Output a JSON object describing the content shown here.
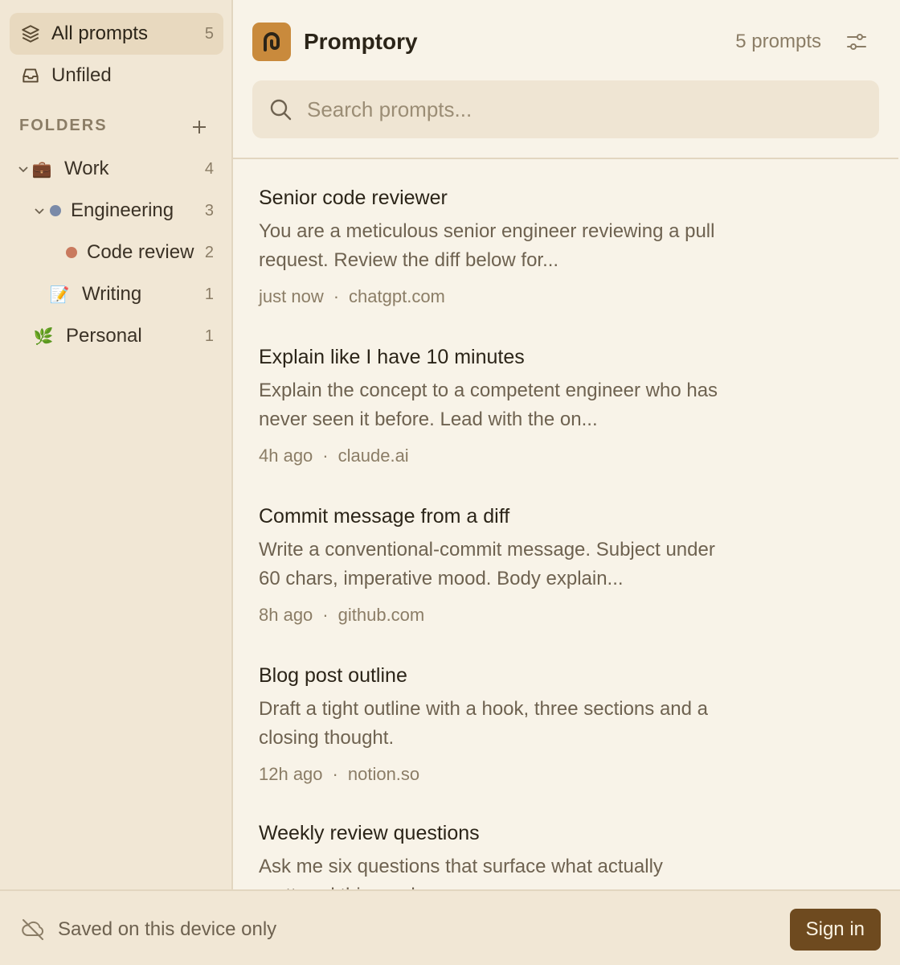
{
  "sidebar": {
    "all_prompts": {
      "label": "All prompts",
      "count": "5",
      "icon": "layers-icon"
    },
    "unfiled": {
      "label": "Unfiled",
      "icon": "inbox-icon"
    },
    "folders_label": "FOLDERS",
    "folders": [
      {
        "label": "Work",
        "count": "4",
        "icon": "briefcase",
        "emoji": "💼",
        "expanded": true
      },
      {
        "label": "Engineering",
        "count": "3",
        "dot_color": "#7a8aa8",
        "expanded": true
      },
      {
        "label": "Code review",
        "count": "2",
        "dot_color": "#c97a5e"
      },
      {
        "label": "Writing",
        "count": "1",
        "emoji": "📝"
      },
      {
        "label": "Personal",
        "count": "1",
        "emoji": "🌿"
      }
    ]
  },
  "header": {
    "title": "Promptory",
    "prompt_count": "5 prompts",
    "search_placeholder": "Search prompts..."
  },
  "prompts": [
    {
      "title": "Senior code reviewer",
      "body": "You are a meticulous senior engineer reviewing a pull request. Review the diff below for...",
      "time": "just now",
      "sep": "·",
      "source": "chatgpt.com"
    },
    {
      "title": "Explain like I have 10 minutes",
      "body": "Explain the concept to a competent engineer who has never seen it before. Lead with the on...",
      "time": "4h ago",
      "sep": "·",
      "source": "claude.ai"
    },
    {
      "title": "Commit message from a diff",
      "body": "Write a conventional-commit message. Subject under 60 chars, imperative mood. Body explain...",
      "time": "8h ago",
      "sep": "·",
      "source": "github.com"
    },
    {
      "title": "Blog post outline",
      "body": "Draft a tight outline with a hook, three sections and a closing thought.",
      "time": "12h ago",
      "sep": "·",
      "source": "notion.so"
    },
    {
      "title": "Weekly review questions",
      "body": "Ask me six questions that surface what actually mattered this week."
    }
  ],
  "footer": {
    "status": "Saved on this device only",
    "signin_label": "Sign in"
  },
  "colors": {
    "accent": "#6e4a1f",
    "logo": "#c98a3c",
    "sidebar_bg": "#f1e7d5",
    "main_bg": "#f8f3e8"
  }
}
